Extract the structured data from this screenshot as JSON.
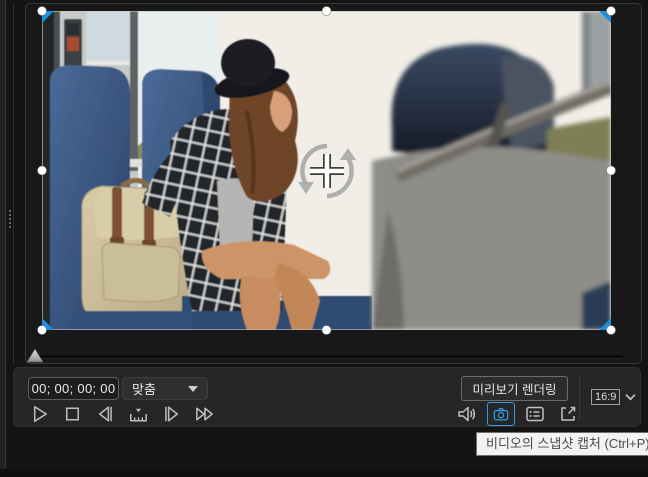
{
  "playback": {
    "timecode": "00; 00; 00; 00",
    "fit_label": "맞춤",
    "render_button_label": "미리보기 렌더링",
    "aspect_label": "16:9",
    "transport_icons": [
      "play",
      "stop",
      "previous-frame",
      "ruler-marker",
      "next-frame",
      "fast-forward"
    ],
    "utility_icons": [
      "volume",
      "snapshot-capture",
      "playlist",
      "detach-window"
    ]
  },
  "tooltip": {
    "text": "비디오의 스냅샷 캡처 (Ctrl+P)"
  },
  "selection": {
    "handle_color": "#ffffff",
    "corner_marker_color": "#1e8fdc"
  },
  "colors": {
    "accent_blue": "#2e9fe8",
    "panel_bg": "#262626",
    "preview_bg": "#181818",
    "tooltip_bg": "#f2f2f2",
    "tooltip_text": "#4a4a4a"
  }
}
